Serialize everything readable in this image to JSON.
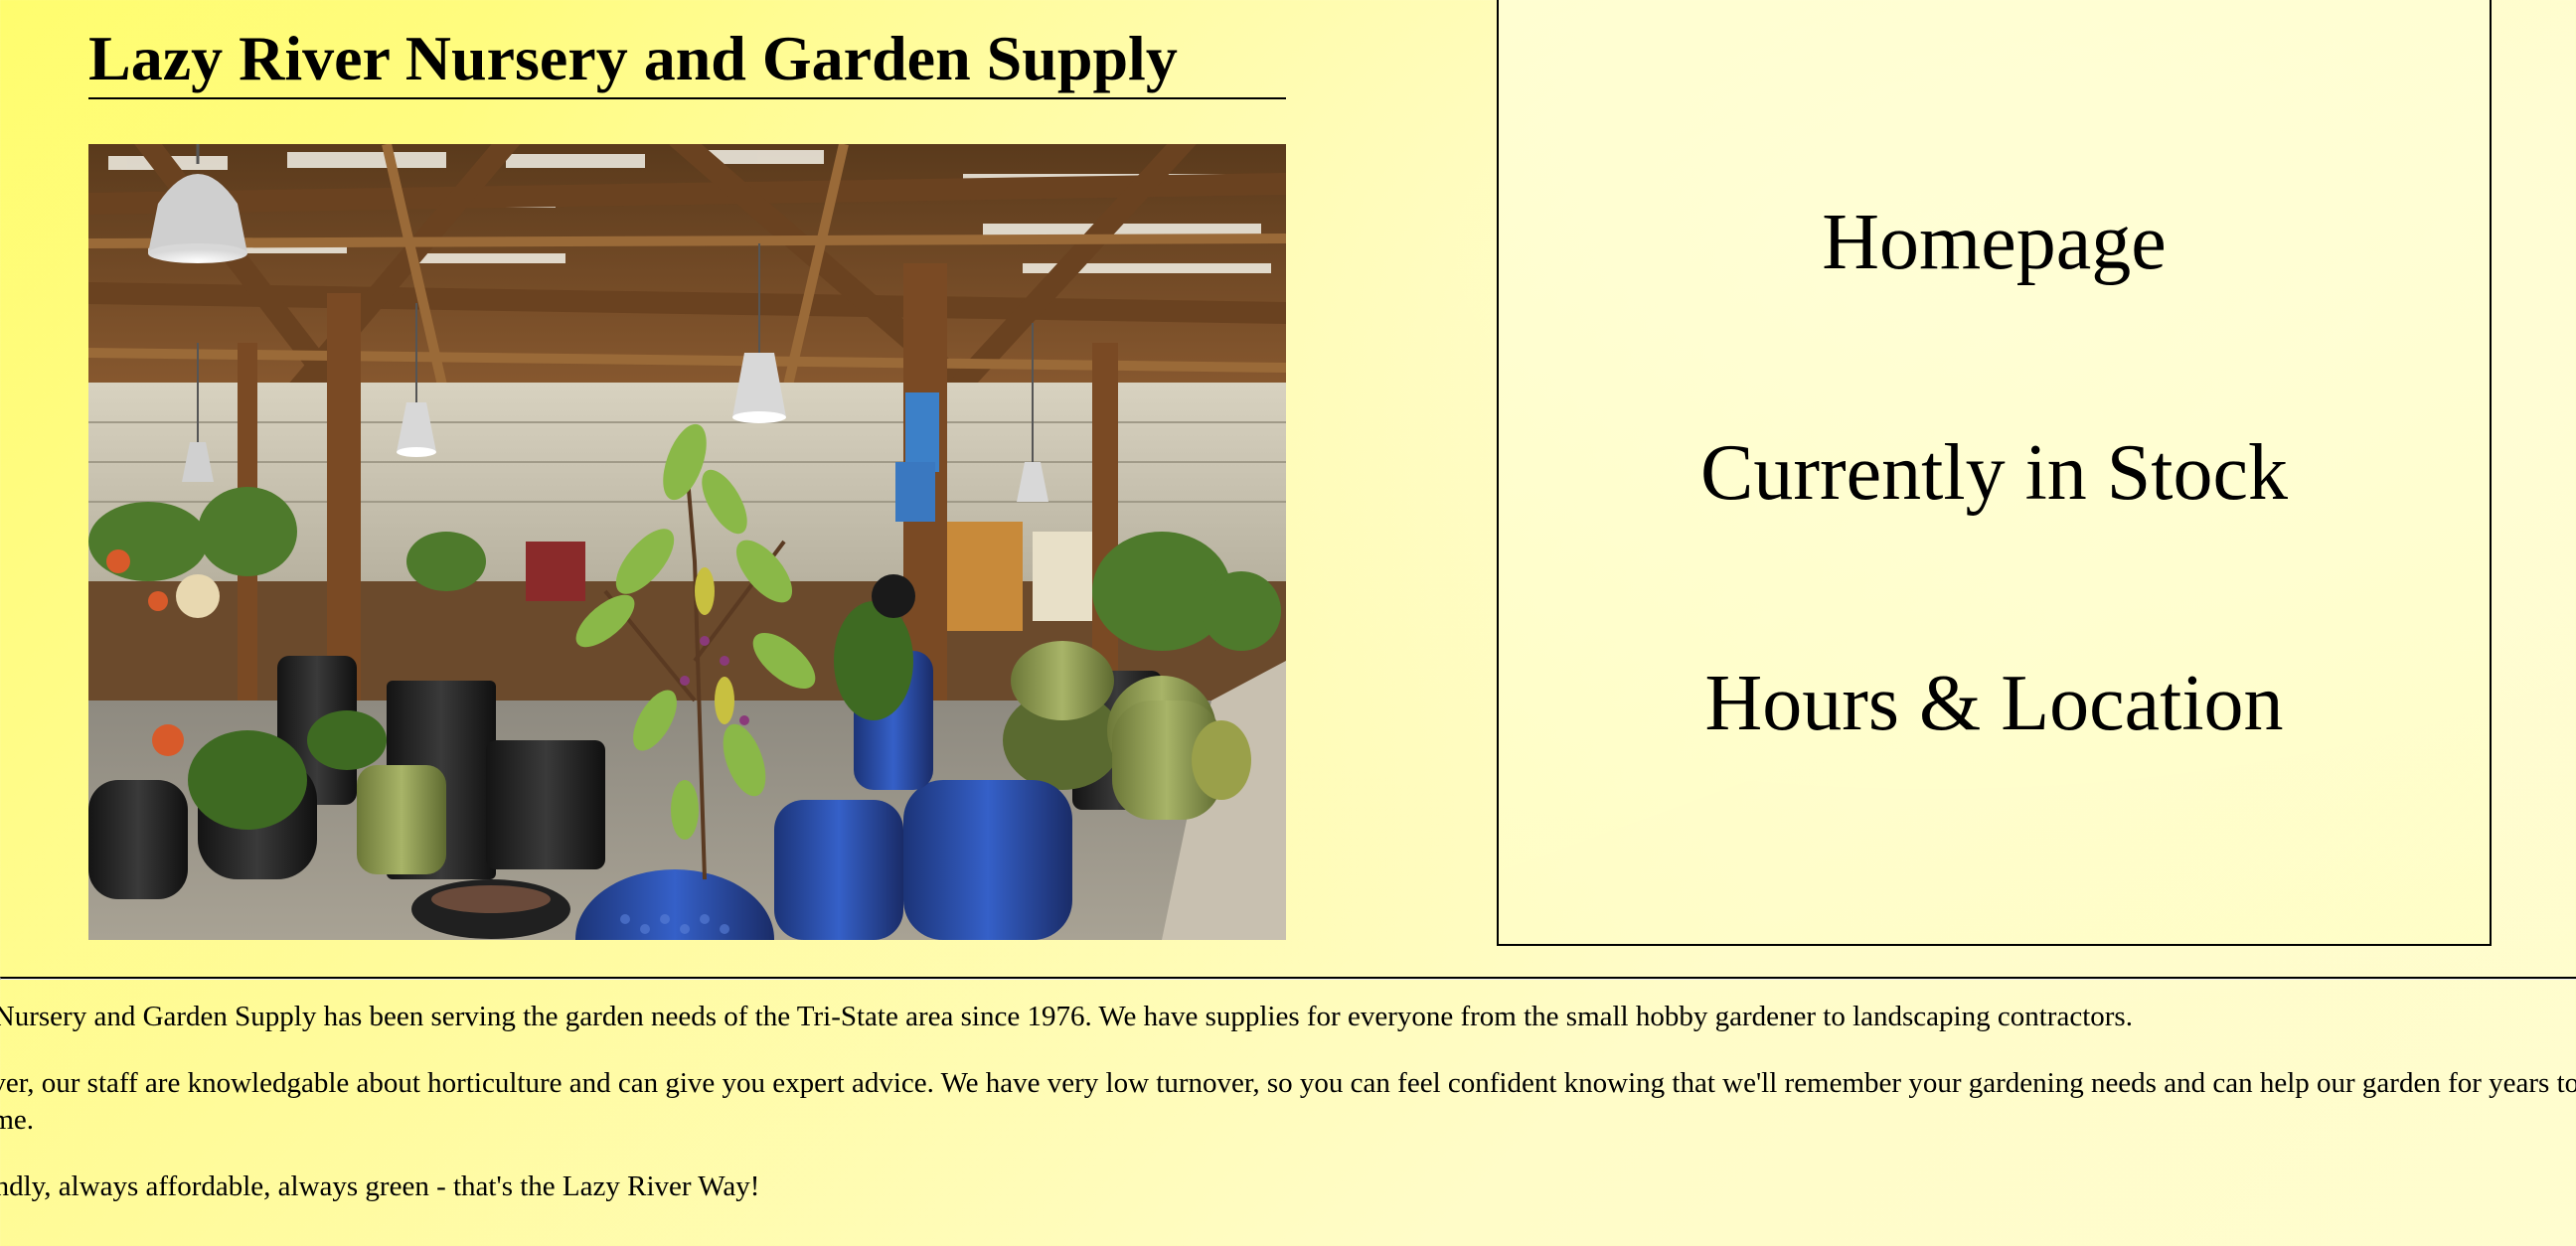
{
  "site": {
    "title": "Lazy River Nursery and Garden Supply"
  },
  "hero": {
    "alt": "Interior of the garden center showing wooden rafters, hanging lamps and glazed ceramic pots",
    "colors": {
      "wood": "#8a5a30",
      "cobalt_pot": "#2c4fa8",
      "green_pot": "#9aa85a",
      "gravel": "#9c9688"
    }
  },
  "nav": {
    "items": [
      {
        "label": "Homepage"
      },
      {
        "label": "Currently in Stock"
      },
      {
        "label": "Hours & Location"
      }
    ]
  },
  "content": {
    "paragraphs": [
      "er Nursery and Garden Supply has been serving the garden needs of the Tri-State area since 1976. We have supplies for everyone from the small hobby gardener to landscaping contractors.",
      "River, our staff are knowledgable about horticulture and can give you expert advice. We have very low turnover, so you can feel confident knowing that we'll remember your gardening needs and can help our garden for years to come.",
      "riendly, always affordable, always green - that's the Lazy River Way!"
    ]
  },
  "theme": {
    "background_from": "#fffd6e",
    "background_to": "#fffdcf",
    "text": "#000000"
  }
}
